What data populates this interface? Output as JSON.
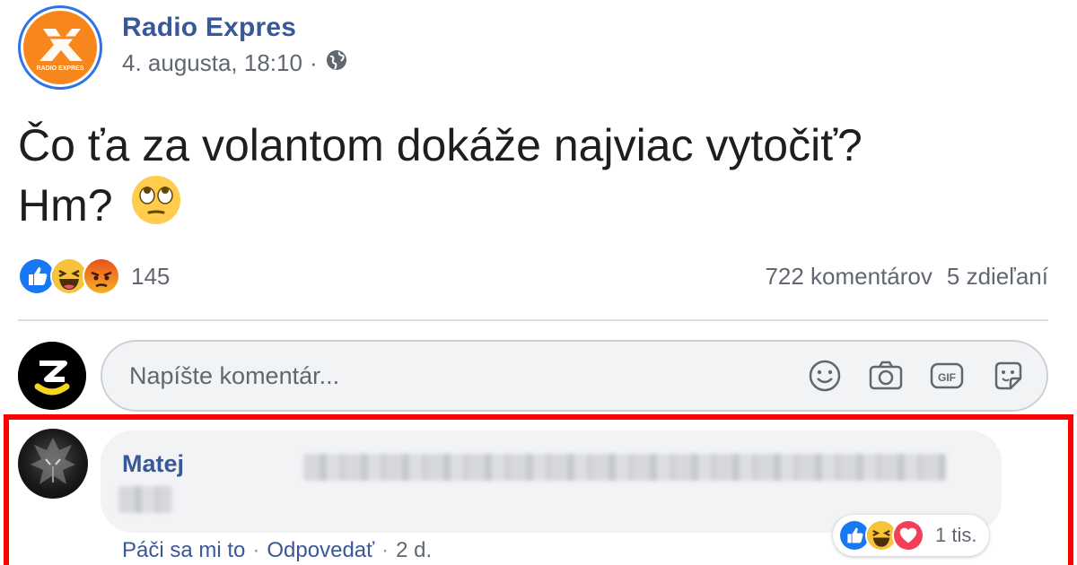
{
  "post": {
    "page_name": "Radio Expres",
    "avatar_text": "RADIO EXPRES",
    "timestamp": "4. augusta, 18:10",
    "separator": "·",
    "audience_icon": "globe-icon",
    "text_line1": "Čo ťa za volantom dokáže najviac vytočiť?",
    "text_line2": "Hm?",
    "emoji": "face-with-rolling-eyes"
  },
  "reactions": {
    "types": [
      "like",
      "haha",
      "angry"
    ],
    "count": "145",
    "comments": "722 komentárov",
    "shares": "5 zdieľaní"
  },
  "composer": {
    "placeholder": "Napíšte komentár...",
    "icons": [
      "emoji-icon",
      "camera-icon",
      "gif-icon",
      "sticker-icon"
    ]
  },
  "comment": {
    "author": "Matej",
    "actions": {
      "like": "Páči sa mi to",
      "reply": "Odpovedať",
      "time": "2 d."
    },
    "reactions": {
      "types": [
        "like",
        "haha",
        "love"
      ],
      "count": "1 tis."
    }
  },
  "colors": {
    "link": "#385898",
    "meta": "#616770",
    "highlight": "#ff0000",
    "brand_orange": "#f7871c"
  }
}
